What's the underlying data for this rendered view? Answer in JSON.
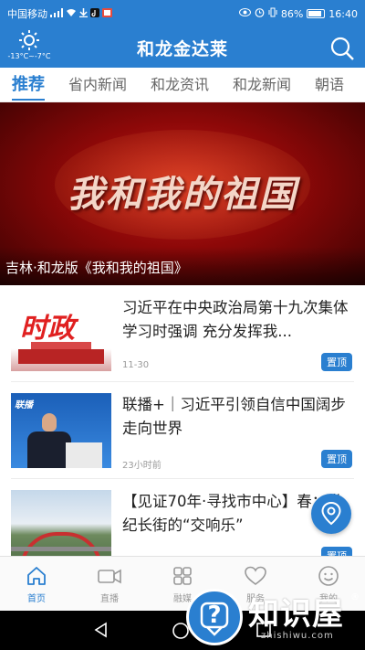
{
  "status_bar": {
    "carrier": "中国移动",
    "signal_icon": "signal-icon",
    "wifi_icon": "wifi-icon",
    "battery_percent": "86%",
    "battery_level": 0.86,
    "time": "16:40"
  },
  "header": {
    "title": "和龙金达莱",
    "weather_temp": "-13°C~-7°C",
    "weather_icon": "sun-icon",
    "search_icon": "search-icon"
  },
  "tabs": [
    {
      "label": "推荐",
      "active": true
    },
    {
      "label": "省内新闻",
      "active": false
    },
    {
      "label": "和龙资讯",
      "active": false
    },
    {
      "label": "和龙新闻",
      "active": false
    },
    {
      "label": "朝语",
      "active": false
    }
  ],
  "banner": {
    "art_text": "我和我的祖国",
    "caption": "吉林·和龙版《我和我的祖国》"
  },
  "news": [
    {
      "title": "习近平在中央政治局第十九次集体学习时强调 充分发挥我...",
      "time": "11-30",
      "badge": "置顶",
      "thumb_text": "时政"
    },
    {
      "title": "联播+｜习近平引领自信中国阔步走向世界",
      "time": "23小时前",
      "badge": "置顶",
      "thumb_text": "联播"
    },
    {
      "title": "【见证70年·寻找市中心】春：世纪长街的“交响乐”",
      "time": "",
      "badge": "置顶",
      "thumb_text": ""
    }
  ],
  "bottom_nav": [
    {
      "label": "首页",
      "icon": "home-icon",
      "active": true
    },
    {
      "label": "直播",
      "icon": "video-camera-icon",
      "active": false
    },
    {
      "label": "融媒",
      "icon": "grid-icon",
      "active": false
    },
    {
      "label": "服务",
      "icon": "heart-icon",
      "active": false
    },
    {
      "label": "我的",
      "icon": "smile-icon",
      "active": false
    }
  ],
  "watermark": {
    "text": "知识屋",
    "reg": "®",
    "url": "zhishiwu.com"
  },
  "colors": {
    "brand_blue": "#2a7fd0",
    "banner_red": "#a80c0c"
  }
}
